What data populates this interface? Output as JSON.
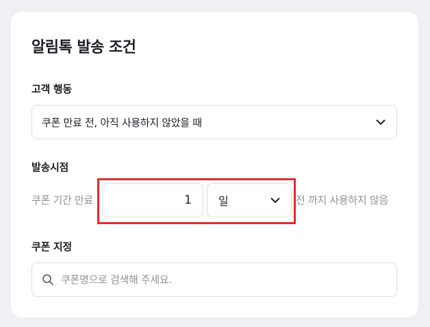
{
  "page": {
    "title": "알림톡 발송 조건"
  },
  "customer_action": {
    "label": "고객 행동",
    "selected": "쿠폰 만료 전, 아직 사용하지 않았을 때"
  },
  "send_timing": {
    "label": "발송시점",
    "prefix": "쿠폰 기간 만료",
    "amount": "1",
    "unit": "일",
    "suffix": "전 까지 사용하지 않음"
  },
  "coupon": {
    "label": "쿠폰 지정",
    "search_placeholder": "쿠폰명으로 검색해 주세요."
  },
  "icons": {
    "dropdown": "chevron-down-icon",
    "search": "search-icon"
  },
  "colors": {
    "background": "#eef0f4",
    "card": "#ffffff",
    "border": "#d9dce1",
    "highlight": "#e02b2b",
    "muted_text": "#8b9099"
  }
}
